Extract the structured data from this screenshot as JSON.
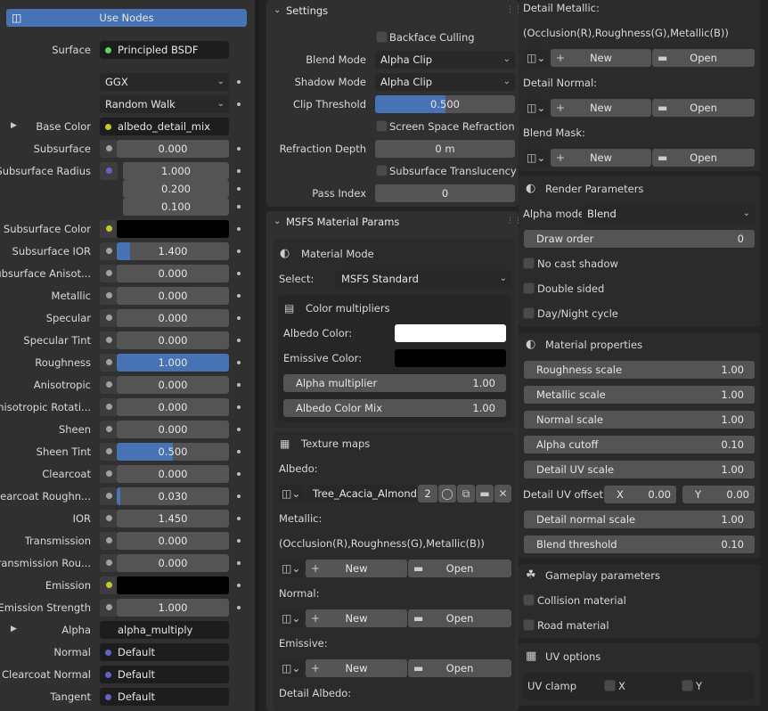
{
  "col1": {
    "use_nodes": "Use Nodes",
    "surface": {
      "label": "Surface",
      "value": "Principled BSDF"
    },
    "distribution": "GGX",
    "subsurface_method": "Random Walk",
    "base_color": {
      "label": "Base Color",
      "value": "albedo_detail_mix"
    },
    "rows": [
      {
        "label": "Subsurface",
        "value": "0.000",
        "fill": 0
      },
      {
        "label": "Subsurface IOR",
        "value": "1.400",
        "fill": 0.12
      },
      {
        "label": "Subsurface Anisot...",
        "value": "0.000",
        "fill": 0
      },
      {
        "label": "Metallic",
        "value": "0.000",
        "fill": 0
      },
      {
        "label": "Specular",
        "value": "0.000",
        "fill": 0
      },
      {
        "label": "Specular Tint",
        "value": "0.000",
        "fill": 0
      },
      {
        "label": "Roughness",
        "value": "1.000",
        "fill": 1
      },
      {
        "label": "Anisotropic",
        "value": "0.000",
        "fill": 0
      },
      {
        "label": "Anisotropic Rotati...",
        "value": "0.000",
        "fill": 0
      },
      {
        "label": "Sheen",
        "value": "0.000",
        "fill": 0
      },
      {
        "label": "Sheen Tint",
        "value": "0.500",
        "fill": 0.5
      },
      {
        "label": "Clearcoat",
        "value": "0.000",
        "fill": 0
      },
      {
        "label": "Clearcoat Roughn...",
        "value": "0.030",
        "fill": 0.03
      },
      {
        "label": "IOR",
        "value": "1.450",
        "fill": 0
      },
      {
        "label": "Transmission",
        "value": "0.000",
        "fill": 0
      },
      {
        "label": "Transmission Rou...",
        "value": "0.000",
        "fill": 0
      },
      {
        "label": "Emission Strength",
        "value": "1.000",
        "fill": 0
      }
    ],
    "subsurface_radius": {
      "label": "Subsurface Radius",
      "values": [
        "1.000",
        "0.200",
        "0.100"
      ]
    },
    "subsurface_color": {
      "label": "Subsurface Color"
    },
    "emission": {
      "label": "Emission"
    },
    "alpha": {
      "label": "Alpha",
      "value": "alpha_multiply"
    },
    "normal": {
      "label": "Normal",
      "value": "Default"
    },
    "clearcoat_normal": {
      "label": "Clearcoat Normal",
      "value": "Default"
    },
    "tangent": {
      "label": "Tangent",
      "value": "Default"
    }
  },
  "col2": {
    "settings_title": "Settings",
    "backface": "Backface Culling",
    "blend_mode": {
      "label": "Blend Mode",
      "value": "Alpha Clip"
    },
    "shadow_mode": {
      "label": "Shadow Mode",
      "value": "Alpha Clip"
    },
    "clip_threshold": {
      "label": "Clip Threshold",
      "value": "0.500",
      "fill": 0.5
    },
    "ssr": "Screen Space Refraction",
    "refraction_depth": {
      "label": "Refraction Depth",
      "value": "0 m"
    },
    "subsurface_translucency": "Subsurface Translucency",
    "pass_index": {
      "label": "Pass Index",
      "value": "0"
    },
    "msfs_title": "MSFS Material Params",
    "material_mode": {
      "title": "Material Mode",
      "select_label": "Select:",
      "select_value": "MSFS Standard"
    },
    "color_mult": {
      "title": "Color multipliers",
      "albedo_color": "Albedo Color:",
      "emissive_color": "Emissive Color:",
      "alpha_mult": {
        "label": "Alpha multiplier",
        "value": "1.00"
      },
      "albedo_mix": {
        "label": "Albedo Color Mix",
        "value": "1.00"
      }
    },
    "texture_maps": {
      "title": "Texture maps",
      "albedo": "Albedo:",
      "albedo_image": "Tree_Acacia_Almond...",
      "albedo_users": "2",
      "metallic": "Metallic:",
      "metallic_hint": "(Occlusion(R),Roughness(G),Metallic(B))",
      "normal": "Normal:",
      "emissive": "Emissive:",
      "detail_albedo": "Detail Albedo:",
      "new": "New",
      "open": "Open"
    }
  },
  "col3": {
    "detail_metallic": "Detail Metallic:",
    "detail_metallic_hint": "(Occlusion(R),Roughness(G),Metallic(B))",
    "detail_normal": "Detail Normal:",
    "blend_mask": "Blend Mask:",
    "new": "New",
    "open": "Open",
    "render_params": {
      "title": "Render Parameters",
      "alpha_mode_label": "Alpha mode:",
      "alpha_mode_value": "Blend",
      "draw_order": {
        "label": "Draw order",
        "value": "0"
      },
      "no_cast_shadow": "No cast shadow",
      "double_sided": "Double sided",
      "day_night": "Day/Night cycle"
    },
    "material_props": {
      "title": "Material properties",
      "rows": [
        {
          "label": "Roughness scale",
          "value": "1.00"
        },
        {
          "label": "Metallic scale",
          "value": "1.00"
        },
        {
          "label": "Normal scale",
          "value": "1.00"
        },
        {
          "label": "Alpha cutoff",
          "value": "0.10"
        },
        {
          "label": "Detail UV scale",
          "value": "1.00"
        }
      ],
      "detail_uv_offset": {
        "label": "Detail UV offset",
        "x_label": "X",
        "x_value": "0.00",
        "y_label": "Y",
        "y_value": "0.00"
      },
      "rows2": [
        {
          "label": "Detail normal scale",
          "value": "1.00"
        },
        {
          "label": "Blend threshold",
          "value": "0.10"
        }
      ]
    },
    "gameplay": {
      "title": "Gameplay parameters",
      "collision": "Collision material",
      "road": "Road material"
    },
    "uv_options": {
      "title": "UV options",
      "uv_clamp": "UV clamp",
      "x": "X",
      "y": "Y"
    }
  }
}
